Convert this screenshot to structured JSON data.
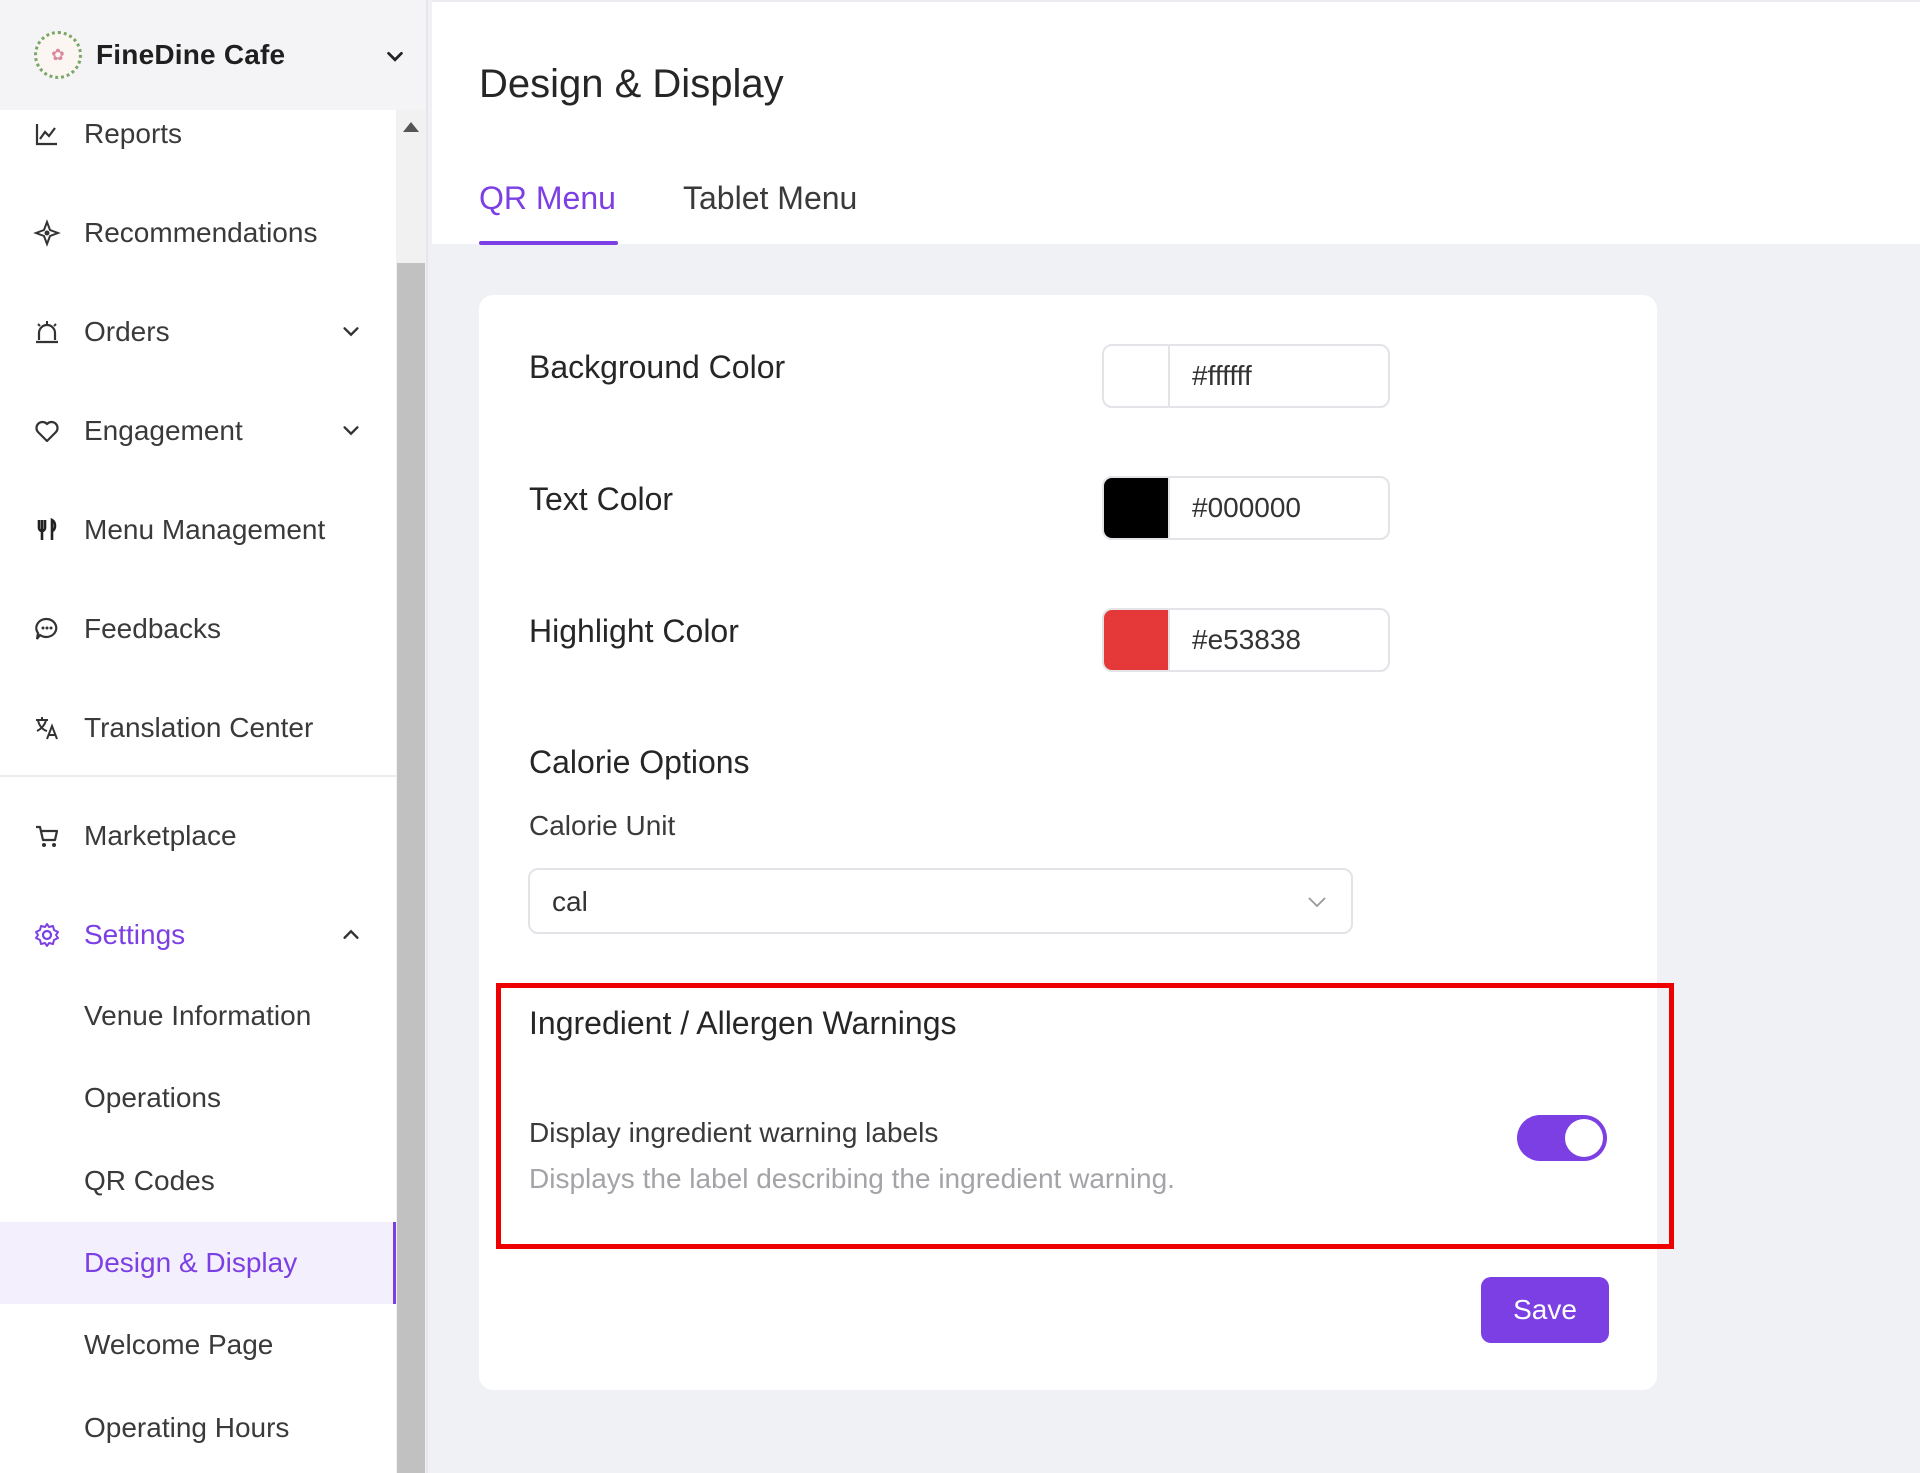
{
  "sidebar": {
    "brand": {
      "name": "FineDine Cafe",
      "logo_icon": "cafe-logo"
    },
    "items": [
      {
        "label": "Reports",
        "icon": "chart-line-icon"
      },
      {
        "label": "Recommendations",
        "icon": "sparkle-icon"
      },
      {
        "label": "Orders",
        "icon": "bell-icon"
      },
      {
        "label": "Engagement",
        "icon": "heart-icon"
      },
      {
        "label": "Menu Management",
        "icon": "utensils-icon"
      },
      {
        "label": "Feedbacks",
        "icon": "chat-icon"
      },
      {
        "label": "Translation Center",
        "icon": "translate-icon"
      },
      {
        "label": "Marketplace",
        "icon": "cart-icon"
      },
      {
        "label": "Settings",
        "icon": "gear-icon"
      }
    ],
    "settings_sub": [
      {
        "label": "Venue Information"
      },
      {
        "label": "Operations"
      },
      {
        "label": "QR Codes"
      },
      {
        "label": "Design & Display"
      },
      {
        "label": "Welcome Page"
      },
      {
        "label": "Operating Hours"
      }
    ]
  },
  "header": {
    "title": "Design & Display",
    "tabs": [
      {
        "label": "QR Menu",
        "active": true
      },
      {
        "label": "Tablet Menu",
        "active": false
      }
    ]
  },
  "form": {
    "background_color": {
      "label": "Background Color",
      "value": "#ffffff"
    },
    "text_color": {
      "label": "Text Color",
      "value": "#000000"
    },
    "highlight_color": {
      "label": "Highlight Color",
      "value": "#e53838"
    },
    "calorie": {
      "section_title": "Calorie Options",
      "unit_label": "Calorie Unit",
      "unit_value": "cal"
    },
    "warnings": {
      "section_title": "Ingredient / Allergen Warnings",
      "toggle_label": "Display ingredient warning labels",
      "toggle_description": "Displays the label describing the ingredient warning.",
      "toggle_on": true
    },
    "save_label": "Save"
  },
  "colors": {
    "accent": "#7b3fe4",
    "annotation_box": "#ee0000"
  }
}
